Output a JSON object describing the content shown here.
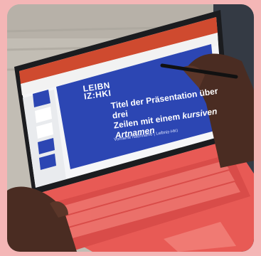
{
  "photo": {
    "slide": {
      "logo_line1": "LEIBN",
      "logo_line2": "IZ:HKI",
      "title_line1": "Titel der Präsentation über drei",
      "title_line2a": "Zeilen mit einem ",
      "title_line2b": "kursiven",
      "title_line3": "Artnamen",
      "subtitle": "Vorname Nachname | Leibniz-HKI"
    },
    "colors": {
      "background": "#f4b6b6",
      "slide_blue": "#2c46b3",
      "keyboard_red": "#e55454"
    }
  }
}
